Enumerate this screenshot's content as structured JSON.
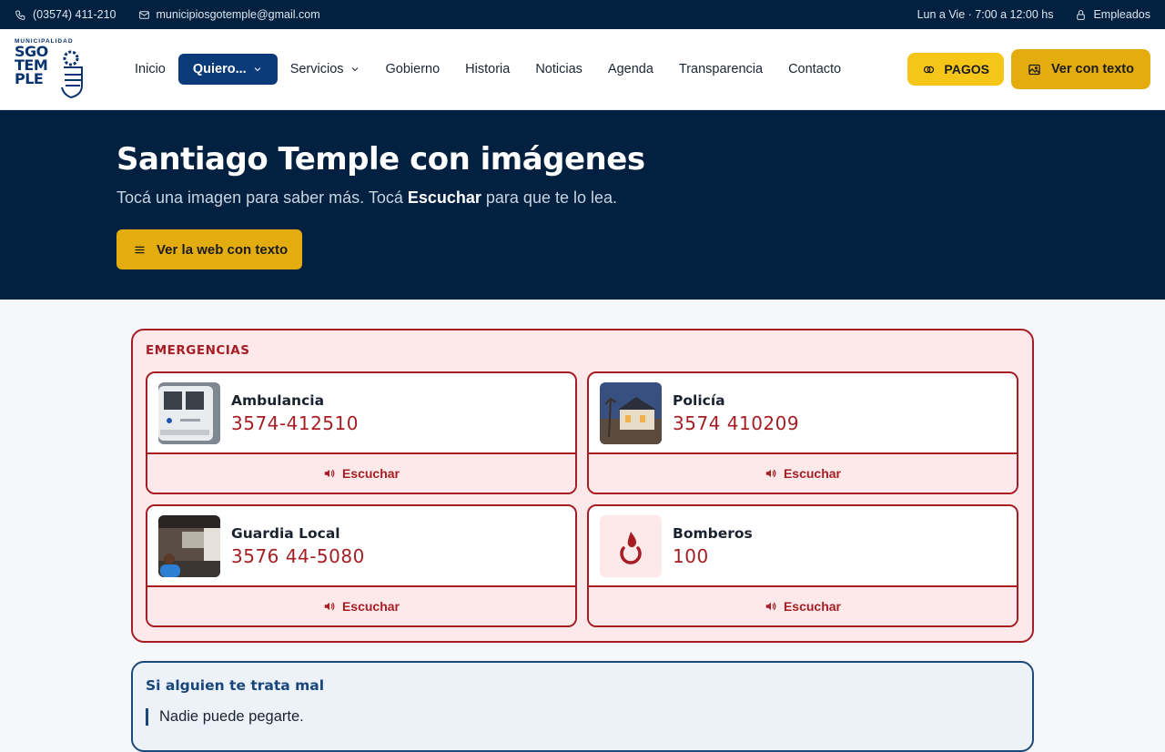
{
  "topbar": {
    "phone": "(03574) 411-210",
    "email": "municipiosgotemple@gmail.com",
    "hours": "Lun a Vie · 7:00 a 12:00 hs",
    "employees": "Empleados"
  },
  "logo": {
    "top": "MUNICIPALIDAD",
    "line1": "SGO",
    "line2": "TEM",
    "line3": "PLE"
  },
  "nav": {
    "items": [
      "Inicio",
      "Quiero...",
      "Servicios",
      "Gobierno",
      "Historia",
      "Noticias",
      "Agenda",
      "Transparencia",
      "Contacto"
    ]
  },
  "actions": {
    "pagos": "PAGOS",
    "ver_con_texto": "Ver con texto"
  },
  "hero": {
    "title": "Santiago Temple con imágenes",
    "subtitle_pre": "Tocá una imagen para saber más. Tocá ",
    "subtitle_strong": "Escuchar",
    "subtitle_post": " para que te lo lea.",
    "cta": "Ver la web con texto"
  },
  "emergencias": {
    "title": "EMERGENCIAS",
    "listen_label": "Escuchar",
    "cards": [
      {
        "name": "Ambulancia",
        "number": "3574-412510"
      },
      {
        "name": "Policía",
        "number": "3574 410209"
      },
      {
        "name": "Guardia Local",
        "number": "3576 44-5080"
      },
      {
        "name": "Bomberos",
        "number": "100"
      }
    ]
  },
  "maltrato": {
    "title": "Si alguien te trata mal",
    "line1": "Nadie puede pegarte."
  },
  "colors": {
    "navy": "#02203f",
    "accent_red": "#a61e24",
    "accent_yellow": "#e3ad0f",
    "pagos_yellow": "#f5c518"
  }
}
